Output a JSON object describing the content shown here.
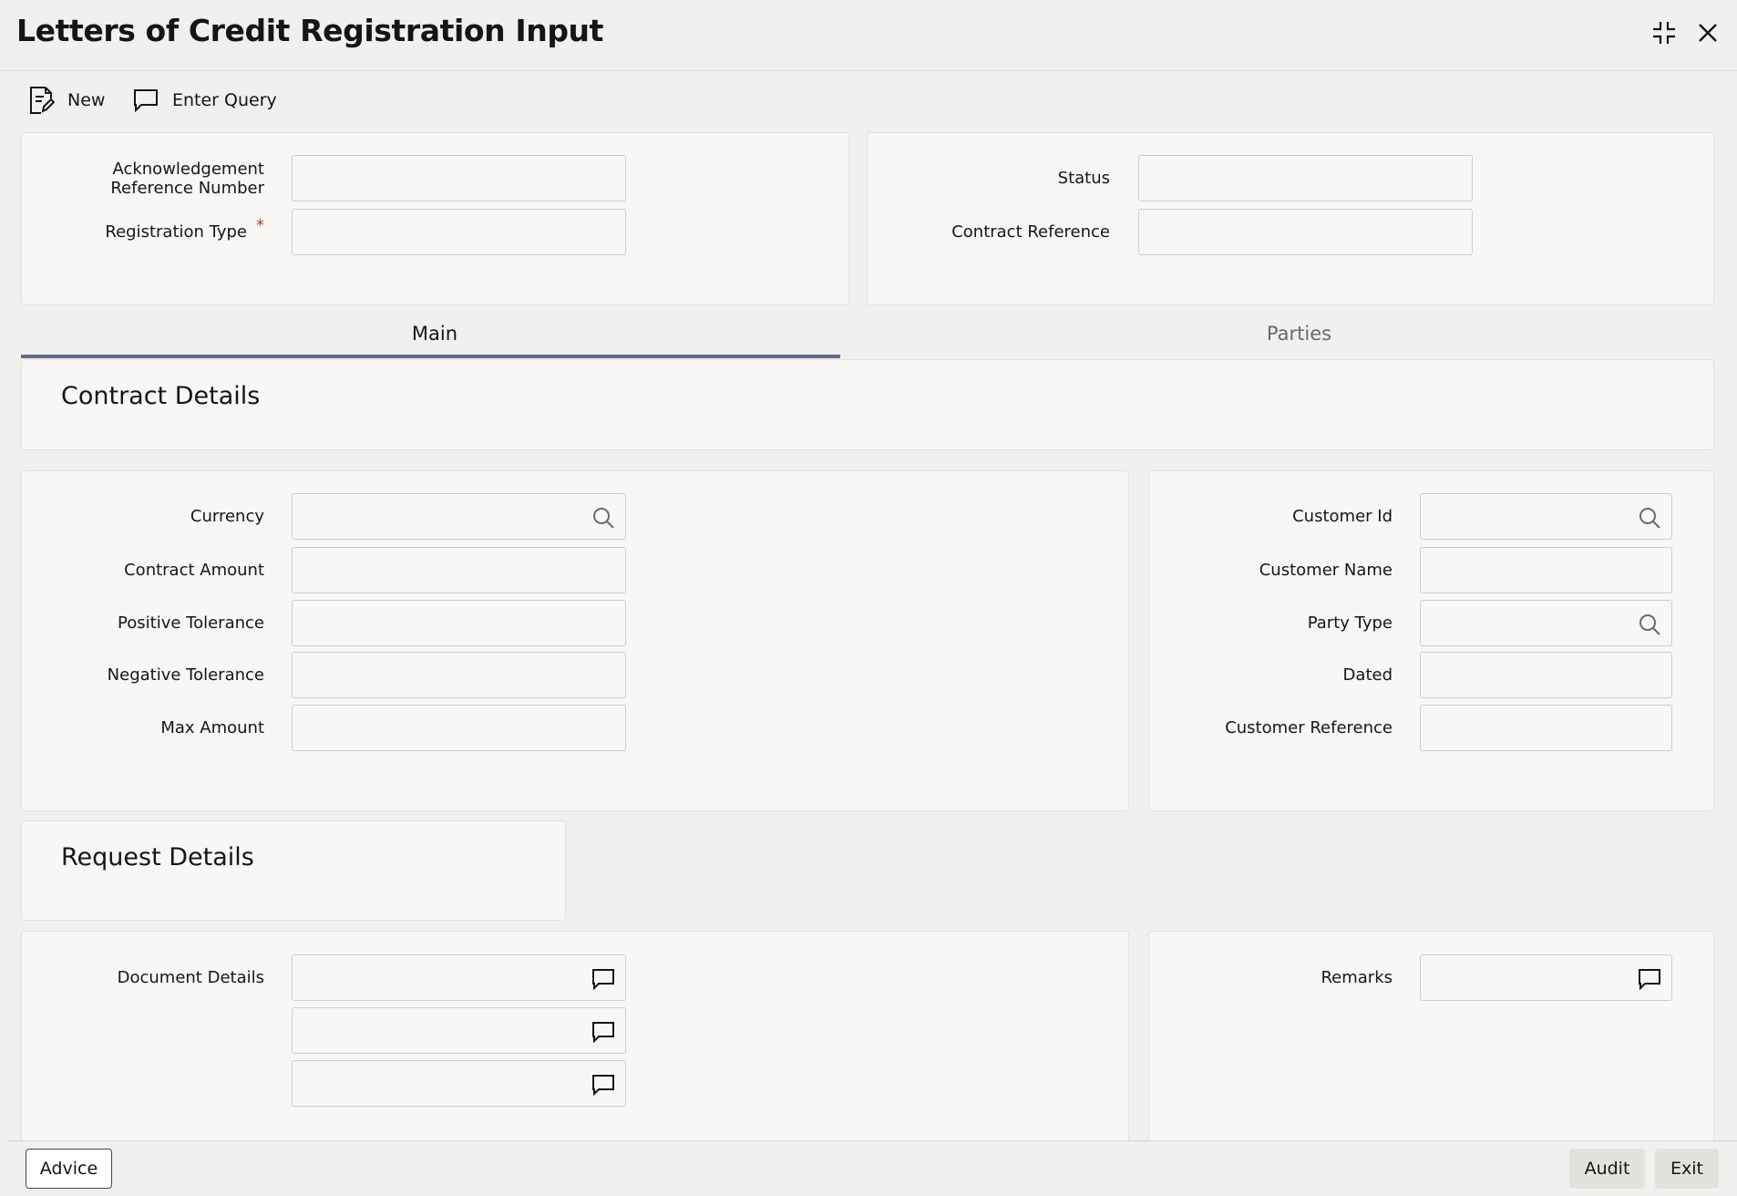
{
  "window": {
    "title": "Letters of Credit Registration Input",
    "controls": [
      "collapse-icon",
      "close-icon"
    ]
  },
  "toolbar": {
    "new_label": "New",
    "enter_query_label": "Enter Query"
  },
  "header_form": {
    "ack_ref_label_line1": "Acknowledgement",
    "ack_ref_label_line2": "Reference Number",
    "ack_ref_value": "",
    "registration_type_label": "Registration Type",
    "registration_type_required": "*",
    "registration_type_value": "",
    "status_label": "Status",
    "status_value": "",
    "contract_reference_label": "Contract Reference",
    "contract_reference_value": ""
  },
  "tabs": [
    {
      "label": "Main",
      "active": true
    },
    {
      "label": "Parties",
      "active": false
    }
  ],
  "contract_details": {
    "title": "Contract Details",
    "currency_label": "Currency",
    "contract_amount_label": "Contract Amount",
    "positive_tolerance_label": "Positive Tolerance",
    "negative_tolerance_label": "Negative Tolerance",
    "max_amount_label": "Max Amount",
    "customer_id_label": "Customer Id",
    "customer_name_label": "Customer Name",
    "party_type_label": "Party Type",
    "dated_label": "Dated",
    "customer_reference_label": "Customer Reference"
  },
  "request_details": {
    "title": "Request Details",
    "document_details_label": "Document Details",
    "remarks_label": "Remarks"
  },
  "footer": {
    "advice_label": "Advice",
    "audit_label": "Audit",
    "exit_label": "Exit"
  },
  "colors": {
    "background": "#f1f0ee",
    "panel": "#f8f7f6",
    "active_tab_underline": "#5e6e8a",
    "required_marker": "#c0392b"
  }
}
